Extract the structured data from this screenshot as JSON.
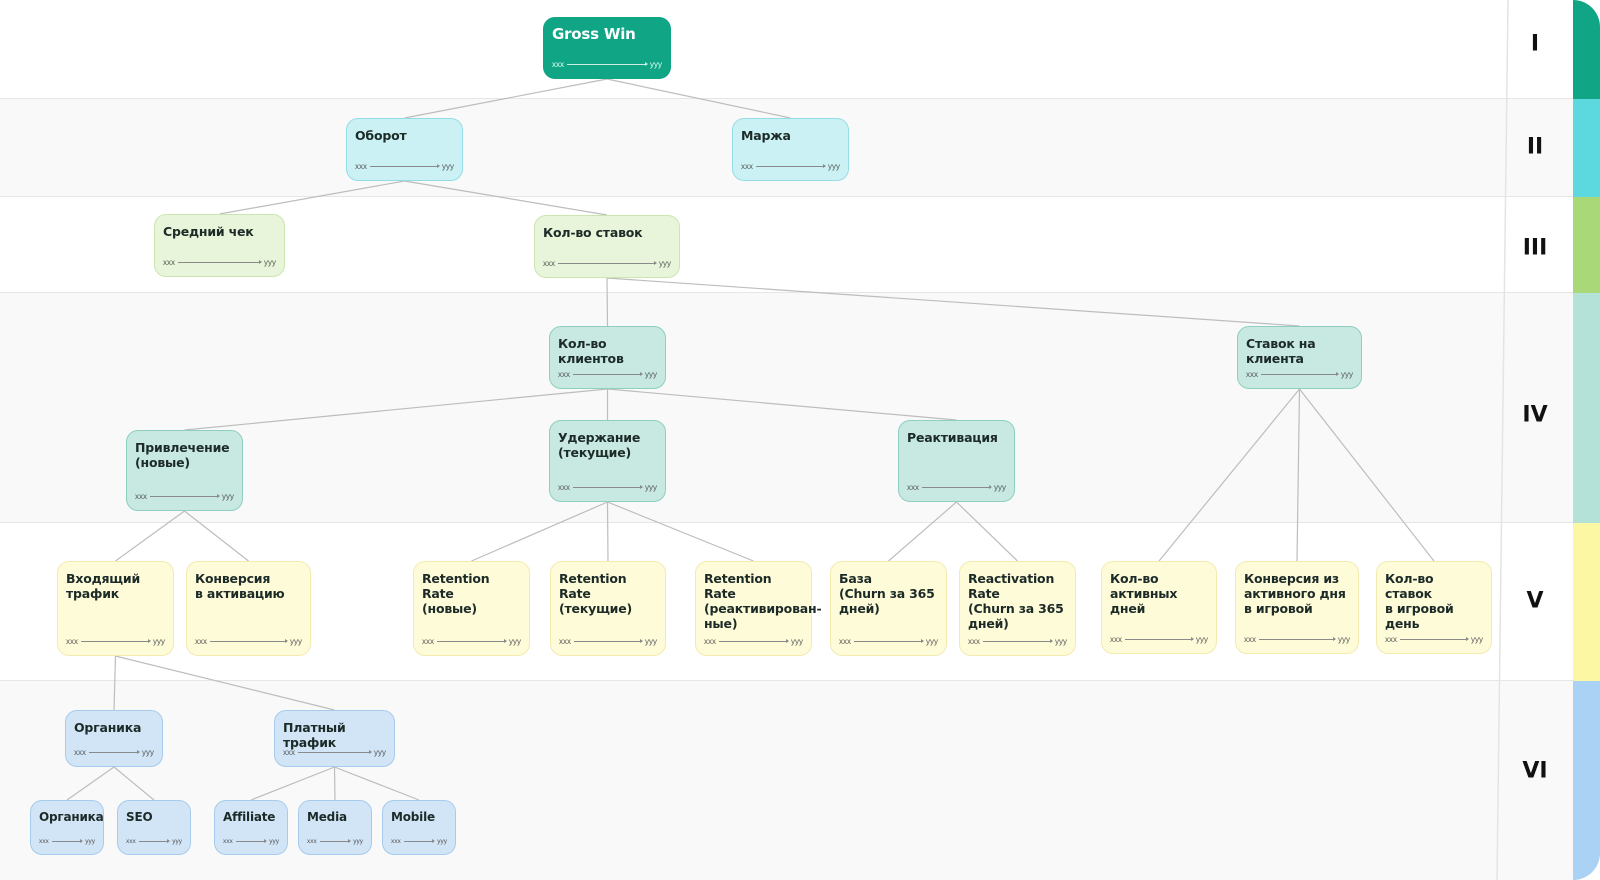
{
  "levels": [
    {
      "label": "I",
      "color": "#0fa585"
    },
    {
      "label": "II",
      "color": "#5bd9de"
    },
    {
      "label": "III",
      "color": "#a8d878"
    },
    {
      "label": "IV",
      "color": "#b4e2d8"
    },
    {
      "label": "V",
      "color": "#fcf7a2"
    },
    {
      "label": "VI",
      "color": "#a9d2f4"
    }
  ],
  "node_styles": {
    "root": {
      "bg": "#0fa585",
      "border": "#0fa585"
    },
    "cyan": {
      "bg": "#cbf1f4",
      "border": "#95dde6"
    },
    "green": {
      "bg": "#e8f5da",
      "border": "#cbe6b1"
    },
    "teal": {
      "bg": "#c7e9e1",
      "border": "#8fcfbf"
    },
    "yellow": {
      "bg": "#fefbd9",
      "border": "#f3eab0"
    },
    "blue": {
      "bg": "#d2e5f7",
      "border": "#a6cbec"
    }
  },
  "nodes": [
    {
      "id": "gross-win",
      "title": "Gross Win",
      "min": "xxx",
      "max": "yyy",
      "style": "root",
      "level": "I"
    },
    {
      "id": "turnover",
      "title": "Оборот",
      "min": "xxx",
      "max": "yyy",
      "style": "cyan",
      "level": "II",
      "parent": "gross-win"
    },
    {
      "id": "margin",
      "title": "Маржа",
      "min": "xxx",
      "max": "yyy",
      "style": "cyan",
      "level": "II",
      "parent": "gross-win"
    },
    {
      "id": "avg-check",
      "title": "Средний чек",
      "min": "xxx",
      "max": "yyy",
      "style": "green",
      "level": "III",
      "parent": "turnover"
    },
    {
      "id": "bets-count",
      "title": "Кол-во ставок",
      "min": "xxx",
      "max": "yyy",
      "style": "green",
      "level": "III",
      "parent": "turnover"
    },
    {
      "id": "clients-count",
      "title": "Кол-во клиентов",
      "min": "xxx",
      "max": "yyy",
      "style": "teal",
      "level": "IV",
      "parent": "bets-count"
    },
    {
      "id": "bets-per-client",
      "title": "Ставок на клиента",
      "min": "xxx",
      "max": "yyy",
      "style": "teal",
      "level": "IV",
      "parent": "bets-count"
    },
    {
      "id": "acquisition",
      "title": "Привлечение\n(новые)",
      "min": "xxx",
      "max": "yyy",
      "style": "teal",
      "level": "IV",
      "parent": "clients-count"
    },
    {
      "id": "retention",
      "title": "Удержание\n(текущие)",
      "min": "xxx",
      "max": "yyy",
      "style": "teal",
      "level": "IV",
      "parent": "clients-count"
    },
    {
      "id": "reactivation",
      "title": "Реактивация",
      "min": "xxx",
      "max": "yyy",
      "style": "teal",
      "level": "IV",
      "parent": "clients-count"
    },
    {
      "id": "incoming-traffic",
      "title": "Входящий\nтрафик",
      "min": "xxx",
      "max": "yyy",
      "style": "yellow",
      "level": "V",
      "parent": "acquisition"
    },
    {
      "id": "activation-conv",
      "title": "Конверсия\nв активацию",
      "min": "xxx",
      "max": "yyy",
      "style": "yellow",
      "level": "V",
      "parent": "acquisition"
    },
    {
      "id": "rr-new",
      "title": "Retention Rate\n(новые)",
      "min": "xxx",
      "max": "yyy",
      "style": "yellow",
      "level": "V",
      "parent": "retention"
    },
    {
      "id": "rr-current",
      "title": "Retention Rate\n(текущие)",
      "min": "xxx",
      "max": "yyy",
      "style": "yellow",
      "level": "V",
      "parent": "retention"
    },
    {
      "id": "rr-reactivated",
      "title": "Retention Rate\n(реактивирован-\nные)",
      "min": "xxx",
      "max": "yyy",
      "style": "yellow",
      "level": "V",
      "parent": "retention"
    },
    {
      "id": "base-churn",
      "title": "База\n(Churn за 365\nдней)",
      "min": "xxx",
      "max": "yyy",
      "style": "yellow",
      "level": "V",
      "parent": "reactivation"
    },
    {
      "id": "reactivation-rate",
      "title": "Reactivation Rate\n(Churn за 365\nдней)",
      "min": "xxx",
      "max": "yyy",
      "style": "yellow",
      "level": "V",
      "parent": "reactivation"
    },
    {
      "id": "active-days",
      "title": "Кол-во\nактивных дней",
      "min": "xxx",
      "max": "yyy",
      "style": "yellow",
      "level": "V",
      "parent": "bets-per-client"
    },
    {
      "id": "active-to-game-conv",
      "title": "Конверсия из\nактивного дня\nв игровой",
      "min": "xxx",
      "max": "yyy",
      "style": "yellow",
      "level": "V",
      "parent": "bets-per-client"
    },
    {
      "id": "bets-per-game-day",
      "title": "Кол-во ставок\nв игровой день",
      "min": "xxx",
      "max": "yyy",
      "style": "yellow",
      "level": "V",
      "parent": "bets-per-client"
    },
    {
      "id": "organic",
      "title": "Органика",
      "min": "xxx",
      "max": "yyy",
      "style": "blue",
      "level": "VI",
      "parent": "incoming-traffic"
    },
    {
      "id": "paid-traffic",
      "title": "Платный трафик",
      "min": "xxx",
      "max": "yyy",
      "style": "blue",
      "level": "VI",
      "parent": "incoming-traffic"
    },
    {
      "id": "organic-sub",
      "title": "Органика",
      "min": "xxx",
      "max": "yyy",
      "style": "blue",
      "level": "VI",
      "parent": "organic"
    },
    {
      "id": "seo",
      "title": "SEO",
      "min": "xxx",
      "max": "yyy",
      "style": "blue",
      "level": "VI",
      "parent": "organic"
    },
    {
      "id": "affiliate",
      "title": "Affiliate",
      "min": "xxx",
      "max": "yyy",
      "style": "blue",
      "level": "VI",
      "parent": "paid-traffic"
    },
    {
      "id": "media",
      "title": "Media",
      "min": "xxx",
      "max": "yyy",
      "style": "blue",
      "level": "VI",
      "parent": "paid-traffic"
    },
    {
      "id": "mobile",
      "title": "Mobile",
      "min": "xxx",
      "max": "yyy",
      "style": "blue",
      "level": "VI",
      "parent": "paid-traffic"
    }
  ]
}
